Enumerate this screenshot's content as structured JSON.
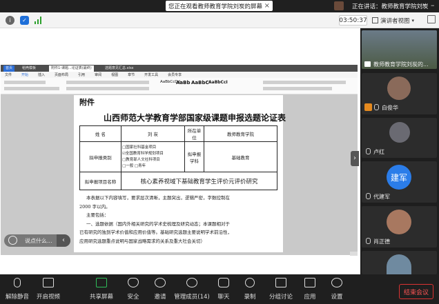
{
  "top_bar": {
    "banner_text": "您正在观看教师教育学院刘炭的屏幕",
    "sharer_label": "正在讲话：教师教育学院刘炭",
    "more": "···"
  },
  "toolbar": {
    "timer": "03:50:37",
    "view_label": "演讲者视图"
  },
  "wps": {
    "tabs": [
      "首页",
      "稻壳模板",
      "附件1-课题...论证表(最终)",
      "选题意见汇总.xlsx"
    ],
    "menu": [
      "文件",
      "开始",
      "插入",
      "页面布局",
      "引用",
      "审阅",
      "视图",
      "章节",
      "开发工具",
      "会员专享"
    ],
    "style_samples": [
      "AaBbCcDd",
      "AaBb",
      "AaBbC",
      "AaBbCcI"
    ]
  },
  "document": {
    "attachment_label": "附件",
    "heading": "山西师范大学教育学部国家级课题申报选题论证表",
    "row1": {
      "label": "姓  名",
      "value": "刘  炭",
      "unit_label": "所在单位",
      "unit_value": "教师教育学院"
    },
    "row2": {
      "label": "拟申报类别",
      "options": [
        "□国家社科基金项目",
        "☑全国教育科学规划项目",
        "□教育部人文社科项目",
        "□一般    □青年"
      ],
      "discipline_label": "拟申报学科",
      "discipline_value": "基础教育"
    },
    "row3": {
      "label": "拟申报项目名称",
      "value": "核心素养视域下基础教育学生评价元评价研究"
    },
    "body": [
      "本表据以下内容填写，要求层次清晰，主题突出，逻辑严密，字数控制在",
      "2000 字以内。",
      "主要包括：",
      "一、选题依据（国内外相关研究的学术史梳理及研究动态；本课题相对于",
      "已有研究的独到学术价值和应用价值等。基础研究选题主要说明学术前沿性，",
      "应用研究选题重点说明与国家战略需求的关系及重大社会关切）"
    ]
  },
  "overlay": {
    "comment_placeholder": "说点什么..."
  },
  "participants": [
    {
      "name": "教师教育学院刘炭的..."
    },
    {
      "name": "白俊华"
    },
    {
      "name": "卢红"
    },
    {
      "avatar_text": "建军",
      "name": "代建军"
    },
    {
      "name": "肖正德"
    },
    {
      "name": ""
    }
  ],
  "bottom_bar": {
    "buttons": [
      {
        "label": "解除静音"
      },
      {
        "label": "开启视频"
      },
      {
        "label": "共享屏幕"
      },
      {
        "label": "安全"
      },
      {
        "label": "邀请"
      },
      {
        "label": "管理成员(14)"
      },
      {
        "label": "聊天"
      },
      {
        "label": "录制"
      },
      {
        "label": "分组讨论"
      },
      {
        "label": "应用"
      },
      {
        "label": "设置"
      }
    ],
    "end_label": "结束会议"
  },
  "colors": {
    "accent_red": "#e53935",
    "blue_avatar": "#2b7de9",
    "bg_dark": "#1f1f1f"
  }
}
